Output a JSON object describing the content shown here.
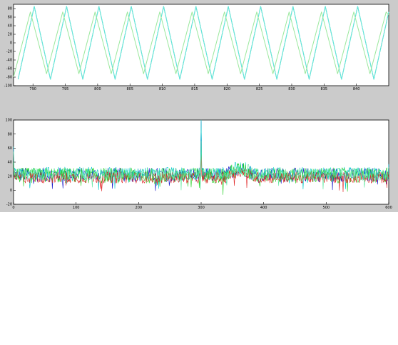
{
  "colors": {
    "figure_bg": "#cbcbcb",
    "axes_bg": "#ffffff",
    "axis": "#000000"
  },
  "chart_data": [
    {
      "type": "line",
      "title": "",
      "xlabel": "",
      "ylabel": "",
      "xlim": [
        787,
        845
      ],
      "ylim": [
        -100,
        90
      ],
      "grid": false,
      "xticks": [
        790,
        795,
        800,
        805,
        810,
        815,
        820,
        825,
        830,
        835,
        840
      ],
      "xtick_labels": [
        "790",
        "795",
        "800",
        "805",
        "810",
        "815",
        "820",
        "825",
        "830",
        "835",
        "840"
      ],
      "yticks": [
        80,
        60,
        40,
        20,
        0,
        -20,
        -40,
        -60,
        -80,
        -100
      ],
      "ytick_labels": [
        "80",
        "60",
        "40",
        "20",
        "0",
        "-20",
        "-40",
        "-60",
        "-80",
        "-100"
      ],
      "series": [
        {
          "color": "#2eb88a",
          "description": "triangle wave, period 5, amplitude 85",
          "x": [
            787.7,
            790.2,
            792.7,
            795.2,
            797.7,
            800.2,
            802.7,
            805.2,
            807.7,
            810.2,
            812.7,
            815.2,
            817.7,
            820.2,
            822.7,
            825.2,
            827.7,
            830.2,
            832.7,
            835.2,
            837.7,
            840.2,
            842.7,
            845.0
          ],
          "y": [
            -85,
            85,
            -85,
            85,
            -85,
            85,
            -85,
            85,
            -85,
            85,
            -85,
            85,
            -85,
            85,
            -85,
            85,
            -85,
            85,
            -85,
            85,
            -85,
            85,
            -85,
            72
          ]
        },
        {
          "color": "#66e8e0",
          "description": "triangle wave, period 5, amplitude 85",
          "x": [
            787.7,
            790.2,
            792.7,
            795.2,
            797.7,
            800.2,
            802.7,
            805.2,
            807.7,
            810.2,
            812.7,
            815.2,
            817.7,
            820.2,
            822.7,
            825.2,
            827.7,
            830.2,
            832.7,
            835.2,
            837.7,
            840.2,
            842.7,
            845.0
          ],
          "y": [
            -85,
            85,
            -85,
            85,
            -85,
            85,
            -85,
            85,
            -85,
            85,
            -85,
            85,
            -85,
            85,
            -85,
            85,
            -85,
            85,
            -85,
            85,
            -85,
            85,
            -85,
            72
          ]
        },
        {
          "color": "#9ae89c",
          "description": "triangle wave slightly phase-shifted",
          "x": [
            787.0,
            789.6,
            792.1,
            794.6,
            797.1,
            799.6,
            802.1,
            804.6,
            807.1,
            809.6,
            812.1,
            814.6,
            817.1,
            819.6,
            822.1,
            824.6,
            827.1,
            829.6,
            832.1,
            834.6,
            837.1,
            839.6,
            842.1,
            844.6,
            845.0
          ],
          "y": [
            -80,
            72,
            -72,
            72,
            -72,
            72,
            -72,
            72,
            -72,
            72,
            -72,
            72,
            -72,
            72,
            -72,
            72,
            -72,
            72,
            -72,
            72,
            -72,
            72,
            -72,
            72,
            65
          ]
        }
      ]
    },
    {
      "type": "line",
      "title": "",
      "xlabel": "",
      "ylabel": "",
      "xlim": [
        0,
        600
      ],
      "ylim": [
        -20,
        100
      ],
      "grid": false,
      "xticks": [
        0,
        100,
        200,
        300,
        400,
        500,
        600
      ],
      "xtick_labels": [
        "0",
        "100",
        "200",
        "300",
        "400",
        "500",
        "600"
      ],
      "yticks": [
        100,
        80,
        60,
        40,
        20,
        0,
        -20
      ],
      "ytick_labels": [
        "100",
        "80",
        "60",
        "40",
        "20",
        "0",
        "-20"
      ],
      "series": [
        {
          "color": "#1010c8",
          "baseline": 22,
          "spread": 10,
          "spike_x": 300,
          "spike_y": 98,
          "start_y": 60
        },
        {
          "color": "#00c8c8",
          "baseline": 24,
          "spread": 9,
          "spike_x": 300,
          "spike_y": 100,
          "start_y": 62
        },
        {
          "color": "#20d020",
          "baseline": 21,
          "spread": 11,
          "spike_x": 300,
          "spike_y": 58,
          "start_y": 40
        },
        {
          "color": "#e02020",
          "baseline": 18,
          "spread": 8,
          "spike_x": 300,
          "spike_y": 50,
          "start_y": 30
        },
        {
          "color": "#60e8a0",
          "baseline": 23,
          "spread": 9,
          "spike_x": 300,
          "spike_y": 70,
          "start_y": 55
        }
      ],
      "notes": "dense noisy traces around 20, bump near x=360-370 reaching ~35, sharp spike at x=300 reaching ~100"
    }
  ]
}
